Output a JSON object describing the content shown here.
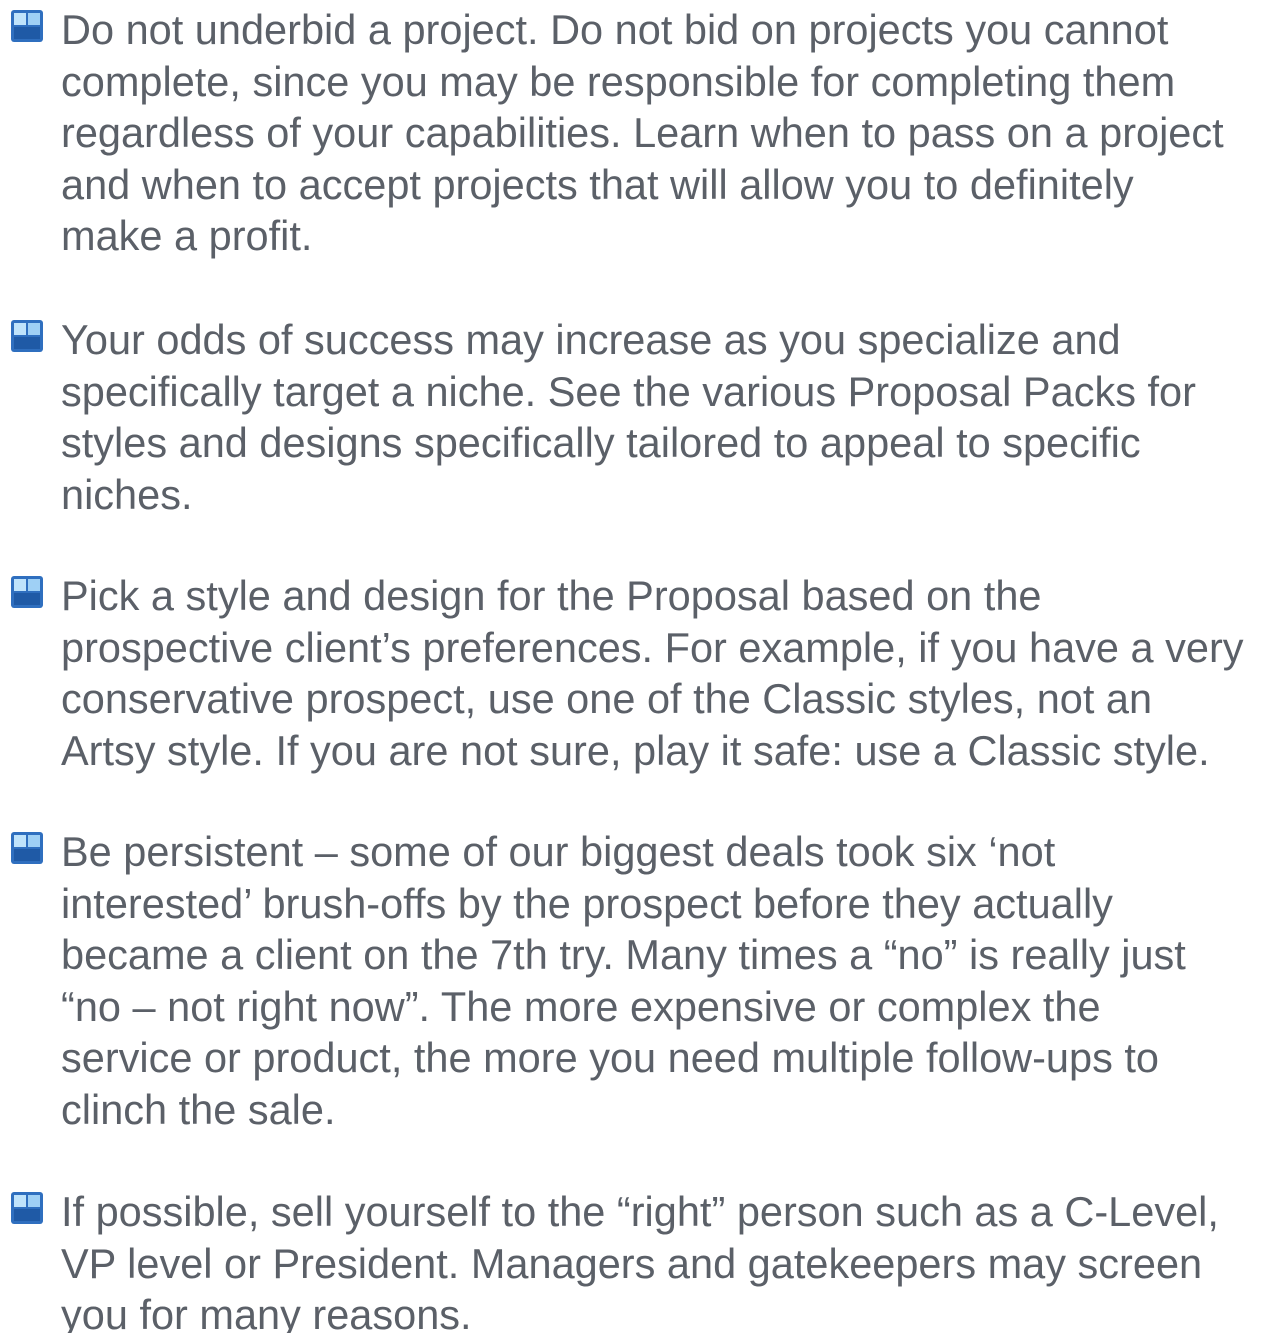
{
  "document": {
    "bullet_icon": "blue-square-bullet-icon",
    "colors": {
      "text": "#5b6068",
      "bullet_dark": "#2f6fbf",
      "bullet_light": "#9fd0f5"
    },
    "tips": [
      {
        "lines": [
          "Do not underbid a project. Do not bid on projects you cannot",
          "complete,   since you may be responsible for completing them",
          "regardless of your capabilities. Learn when to pass on a project",
          "and when to accept projects that will allow you to definitely",
          "make a profit."
        ]
      },
      {
        "lines": [
          "Your odds of success may increase as you specialize and",
          "specifically target a niche. See the various Proposal Packs for",
          "styles and designs specifically tailored to appeal to specific",
          "niches."
        ]
      },
      {
        "lines": [
          "Pick a style and design for the Proposal based on the",
          "prospective client’s preferences. For example, if you have a very",
          "conservative prospect, use one of the Classic styles, not an",
          "Artsy style. If you are not sure, play it safe:   use a Classic style."
        ]
      },
      {
        "lines": [
          "Be persistent – some of our biggest deals took six ‘not",
          "interested’ brush-offs by the prospect before they actually",
          "became a client on the 7th try. Many times a “no” is really just",
          "“no – not right now”. The more expensive or complex the",
          "service or product, the more you need multiple follow-ups to",
          "clinch the sale."
        ]
      },
      {
        "lines": [
          "If possible, sell yourself to the “right” person such as a C-Level,",
          "VP level or President. Managers and gatekeepers may screen",
          "you for many reasons."
        ]
      }
    ]
  }
}
